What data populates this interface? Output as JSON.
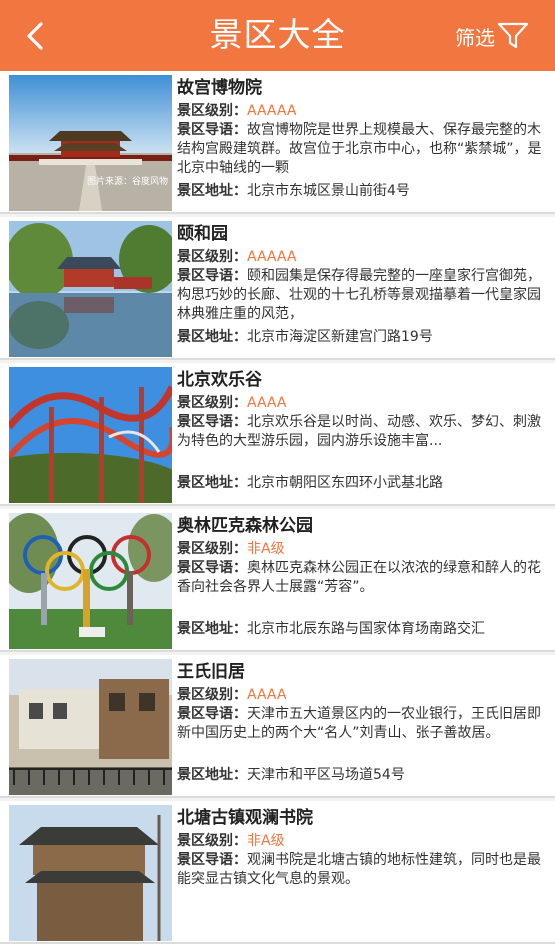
{
  "header": {
    "title": "景区大全",
    "filter_label": "筛选",
    "background_color": "#f2763f"
  },
  "labels": {
    "level": "景区级别：",
    "guide": "景区导语：",
    "address": "景区地址："
  },
  "spots": [
    {
      "name": "故宫博物院",
      "level": "AAAAA",
      "guide": "故宫博物院是世界上规模最大、保存最完整的木结构宫殿建筑群。故宫位于北京市中心，也称“紫禁城”，是北京中轴线的一颗",
      "address": "北京市东城区景山前街4号",
      "image_caption": "图片来源：谷度风物"
    },
    {
      "name": "颐和园",
      "level": "AAAAA",
      "guide": "颐和园集是保存得最完整的一座皇家行宫御苑，构思巧妙的长廊、壮观的十七孔桥等景观描摹着一代皇家园林典雅庄重的风范，",
      "address": "北京市海淀区新建宫门路19号"
    },
    {
      "name": "北京欢乐谷",
      "level": "AAAA",
      "guide": "北京欢乐谷是以时尚、动感、欢乐、梦幻、刺激为特色的大型游乐园，园内游乐设施丰富...",
      "address": "北京市朝阳区东四环小武基北路"
    },
    {
      "name": "奥林匹克森林公园",
      "level": "非A级",
      "guide": "奥林匹克森林公园正在以浓浓的绿意和醉人的花香向社会各界人士展露“芳容”。",
      "address": "北京市北辰东路与国家体育场南路交汇"
    },
    {
      "name": "王氏旧居",
      "level": "AAAA",
      "guide": "天津市五大道景区内的一农业银行，王氏旧居即新中国历史上的两个大“名人”刘青山、张子善故居。",
      "address": "天津市和平区马场道54号"
    },
    {
      "name": "北塘古镇观澜书院",
      "level": "非A级",
      "guide": "观澜书院是北塘古镇的地标性建筑，同时也是最能突显古镇文化气息的景观。",
      "address": ""
    }
  ]
}
